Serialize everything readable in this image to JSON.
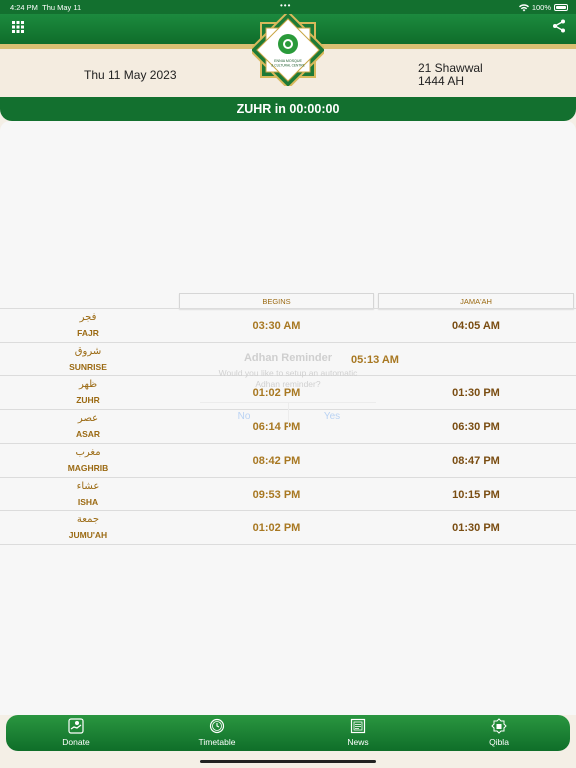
{
  "status_bar": {
    "time": "4:24 PM",
    "date": "Thu May 11",
    "dots": "•••",
    "battery": "100%"
  },
  "header": {
    "gregorian_date": "Thu 11 May 2023",
    "hijri_line1": "21 Shawwal",
    "hijri_line2": "1444 AH",
    "logo_text_line1": "ENNIA MOSQUE",
    "logo_text_line2": "& CULTURAL CENTRE"
  },
  "countdown": "ZUHR in 00:00:00",
  "table": {
    "col_begins": "BEGINS",
    "col_jamaah": "JAMA'AH",
    "rows": [
      {
        "arabic": "فجر",
        "name": "FAJR",
        "begins": "03:30 AM",
        "jamaah": "04:05 AM"
      },
      {
        "arabic": "شروق",
        "name": "SUNRISE",
        "begins": "05:13 AM",
        "jamaah": ""
      },
      {
        "arabic": "ظهر",
        "name": "ZUHR",
        "begins": "01:02 PM",
        "jamaah": "01:30 PM"
      },
      {
        "arabic": "عصر",
        "name": "ASAR",
        "begins": "06:14 PM",
        "jamaah": "06:30 PM"
      },
      {
        "arabic": "مغرب",
        "name": "MAGHRIB",
        "begins": "08:42 PM",
        "jamaah": "08:47 PM"
      },
      {
        "arabic": "عشاء",
        "name": "ISHA",
        "begins": "09:53 PM",
        "jamaah": "10:15 PM"
      },
      {
        "arabic": "جمعة",
        "name": "JUMU'AH",
        "begins": "01:02 PM",
        "jamaah": "01:30 PM"
      }
    ]
  },
  "dialog": {
    "title": "Adhan Reminder",
    "message_line1": "Would you like to setup an automatic",
    "message_line2": "Adhan reminder?",
    "no": "No",
    "yes": "Yes"
  },
  "tabs": [
    {
      "label": "Donate",
      "icon": "donate-icon"
    },
    {
      "label": "Timetable",
      "icon": "clock-icon"
    },
    {
      "label": "News",
      "icon": "news-icon"
    },
    {
      "label": "Qibla",
      "icon": "qibla-icon"
    }
  ],
  "colors": {
    "green": "#13702f",
    "gold": "#9b6a13",
    "cream": "#f4ece0"
  }
}
